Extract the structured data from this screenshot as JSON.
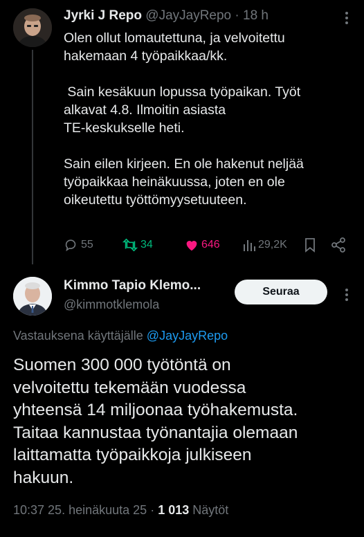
{
  "tweet1": {
    "author_name": "Jyrki J Repo",
    "handle": "@JayJayRepo",
    "separator": "·",
    "time": "18 h",
    "paragraphs": [
      "Olen ollut lomautettuna, ja velvoitettu\nhakemaan 4 työpaikkaa/kk.",
      " Sain kesäkuun lopussa työpaikan. Työt\nalkavat 4.8. Ilmoitin asiasta\nTE-keskukselle heti.",
      "Sain eilen kirjeen. En ole hakenut neljää\ntyöpaikkaa heinäkuussa, joten en ole\noikeutettu työttömyysetuuteen."
    ],
    "stats": {
      "replies": "55",
      "reposts": "34",
      "likes": "646",
      "views": "29,2K"
    },
    "colors": {
      "repost": "#00ba7c",
      "like": "#f91880"
    }
  },
  "tweet2": {
    "author_name": "Kimmo Tapio Klemo...",
    "handle": "@kimmotklemola",
    "follow_label": "Seuraa",
    "reply_prefix": "Vastauksena käyttäjälle",
    "reply_mention": "@JayJayRepo",
    "text": "Suomen 300 000 työtöntä on\nvelvoitettu tekemään vuodessa\nyhteensä 14 miljoonaa työhakemusta.\nTaitaa kannustaa työnantajia olemaan\nlaittamatta työpaikkoja julkiseen\nhakuun.",
    "timestamp": "10:37 25. heinäkuuta 25",
    "separator": "·",
    "view_count": "1 013",
    "views_label": "Näytöt"
  },
  "icons": [
    "more-icon",
    "reply-icon",
    "repost-icon",
    "heart-icon",
    "views-icon",
    "bookmark-icon",
    "share-icon"
  ]
}
